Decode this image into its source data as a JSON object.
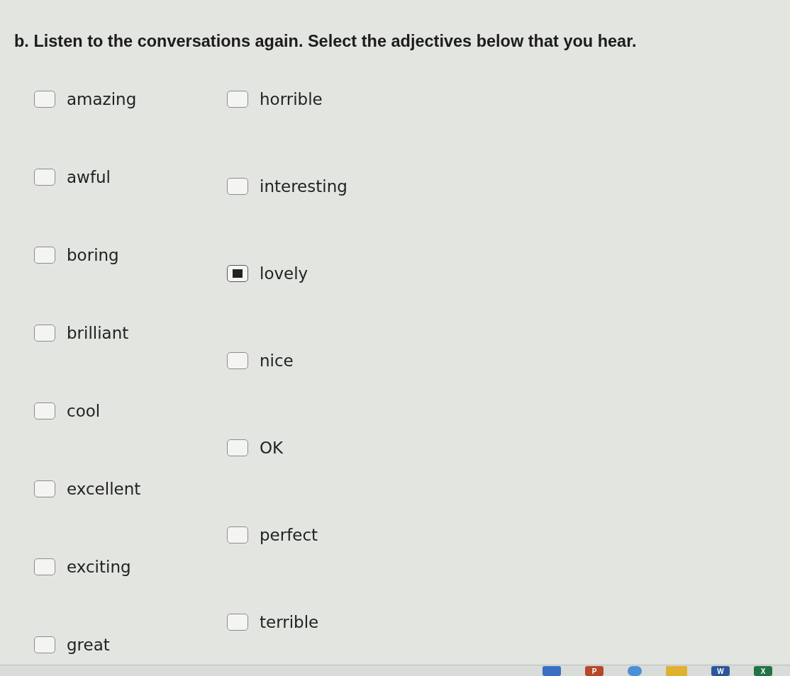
{
  "instruction": "b. Listen to the conversations again. Select the adjectives below that you hear.",
  "options_left": [
    {
      "label": "amazing",
      "checked": false
    },
    {
      "label": "awful",
      "checked": false
    },
    {
      "label": "boring",
      "checked": false
    },
    {
      "label": "brilliant",
      "checked": false
    },
    {
      "label": "cool",
      "checked": false
    },
    {
      "label": "excellent",
      "checked": false
    },
    {
      "label": "exciting",
      "checked": false
    },
    {
      "label": "great",
      "checked": false
    }
  ],
  "options_right": [
    {
      "label": "horrible",
      "checked": false
    },
    {
      "label": "interesting",
      "checked": false
    },
    {
      "label": "lovely",
      "checked": true
    },
    {
      "label": "nice",
      "checked": false
    },
    {
      "label": "OK",
      "checked": false
    },
    {
      "label": "perfect",
      "checked": false
    },
    {
      "label": "terrible",
      "checked": false
    }
  ],
  "taskbar": {
    "icons": [
      {
        "kind": "tile",
        "color": "#3a6fc4"
      },
      {
        "kind": "letter",
        "label": "P",
        "color": "#b7472a"
      },
      {
        "kind": "circle",
        "color": "#4a8fd9"
      },
      {
        "kind": "folder",
        "color": "#e0b030"
      },
      {
        "kind": "letter",
        "label": "W",
        "color": "#2b579a"
      },
      {
        "kind": "letter",
        "label": "X",
        "color": "#217346"
      }
    ]
  }
}
